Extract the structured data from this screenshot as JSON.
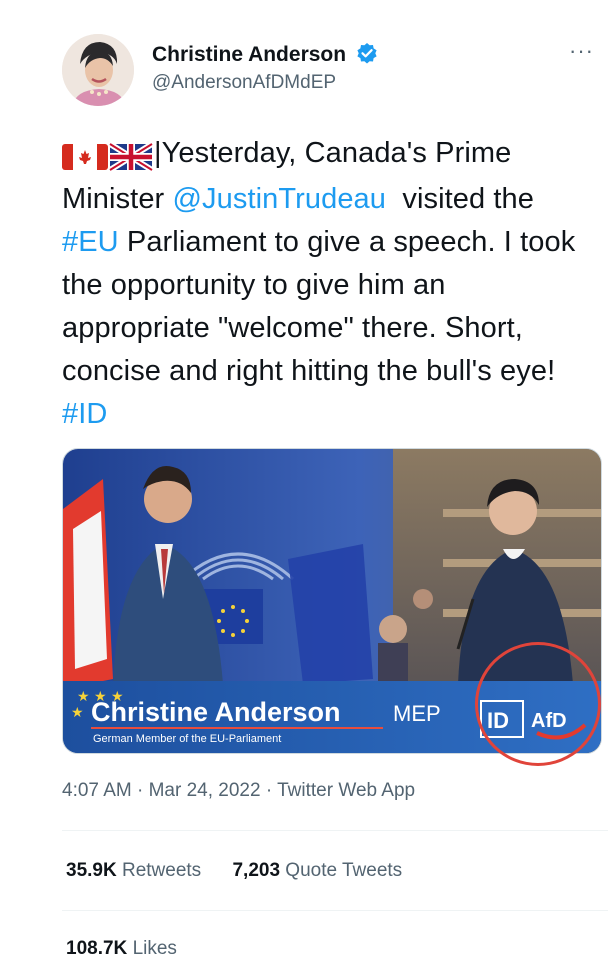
{
  "author": {
    "display_name": "Christine Anderson",
    "handle": "@AndersonAfDMdEP"
  },
  "menu": {
    "more_label": "···"
  },
  "tweet": {
    "text_part1": "|Yesterday, Canada's Prime Minister ",
    "mention": "@JustinTrudeau",
    "text_part2": "  visited the ",
    "hashtag_eu": "#EU",
    "text_part3": " Parliament to give a speech. I took the opportunity to give him an appropriate \"welcome\" there. Short, concise and right hitting the bull's eye! ",
    "hashtag_id": "#ID"
  },
  "media": {
    "banner_name": "Christine Anderson",
    "banner_suffix": "MEP",
    "banner_subtitle": "German Member of the EU-Parliament",
    "id_logo": "ID",
    "party_logo": "AfD"
  },
  "meta": {
    "time": "4:07 AM",
    "date": "Mar 24, 2022",
    "source": "Twitter Web App",
    "separator": " · "
  },
  "stats": {
    "retweets_count": "35.9K",
    "retweets_label": "Retweets",
    "quotes_count": "7,203",
    "quotes_label": "Quote Tweets",
    "likes_count": "108.7K",
    "likes_label": "Likes"
  },
  "colors": {
    "link": "#1d9bf0",
    "secondary_text": "#536471",
    "annotation": "#e0443a",
    "banner_blue": "#1a5ba8"
  },
  "icons": {
    "verified": "verified-badge-icon",
    "canada_flag": "canada-flag-icon",
    "uk_flag": "uk-flag-icon",
    "more": "more-dots-icon"
  }
}
